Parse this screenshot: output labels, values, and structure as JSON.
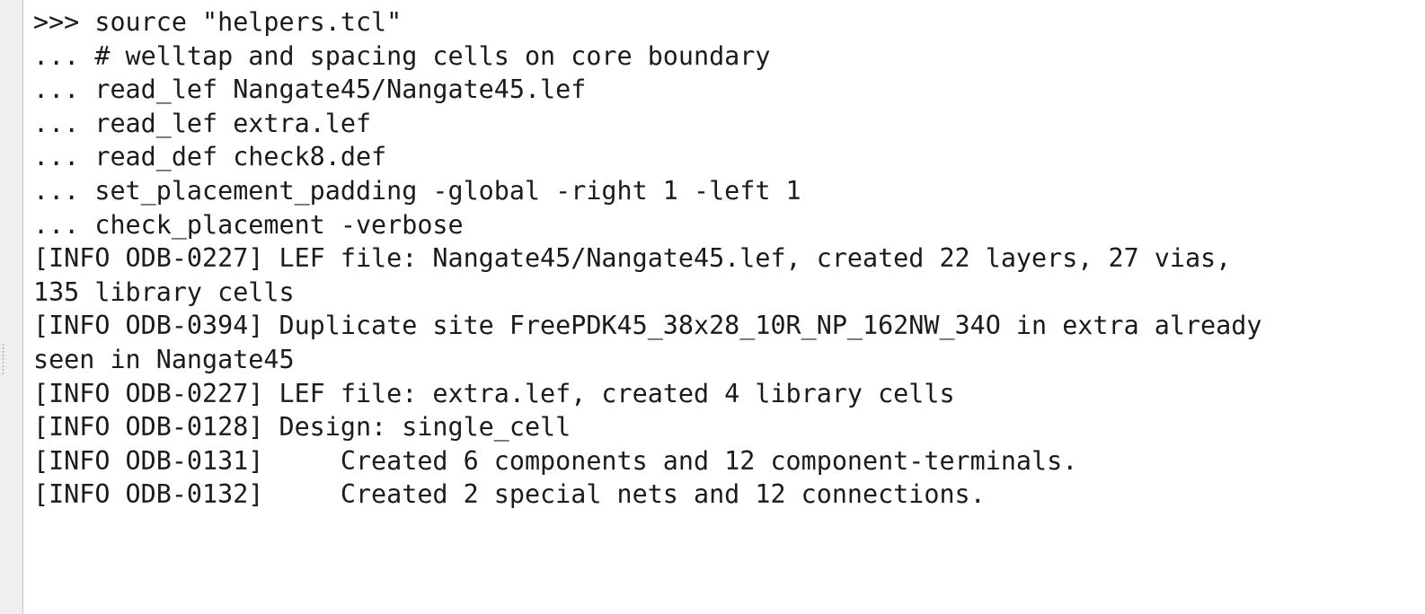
{
  "console": {
    "lines": [
      ">>> source \"helpers.tcl\"",
      "... # welltap and spacing cells on core boundary",
      "... read_lef Nangate45/Nangate45.lef",
      "... read_lef extra.lef",
      "... read_def check8.def",
      "... set_placement_padding -global -right 1 -left 1",
      "... check_placement -verbose",
      "[INFO ODB-0227] LEF file: Nangate45/Nangate45.lef, created 22 layers, 27 vias,",
      "135 library cells",
      "[INFO ODB-0394] Duplicate site FreePDK45_38x28_10R_NP_162NW_34O in extra already",
      "seen in Nangate45",
      "[INFO ODB-0227] LEF file: extra.lef, created 4 library cells",
      "[INFO ODB-0128] Design: single_cell",
      "[INFO ODB-0131]     Created 6 components and 12 component-terminals.",
      "[INFO ODB-0132]     Created 2 special nets and 12 connections."
    ]
  }
}
